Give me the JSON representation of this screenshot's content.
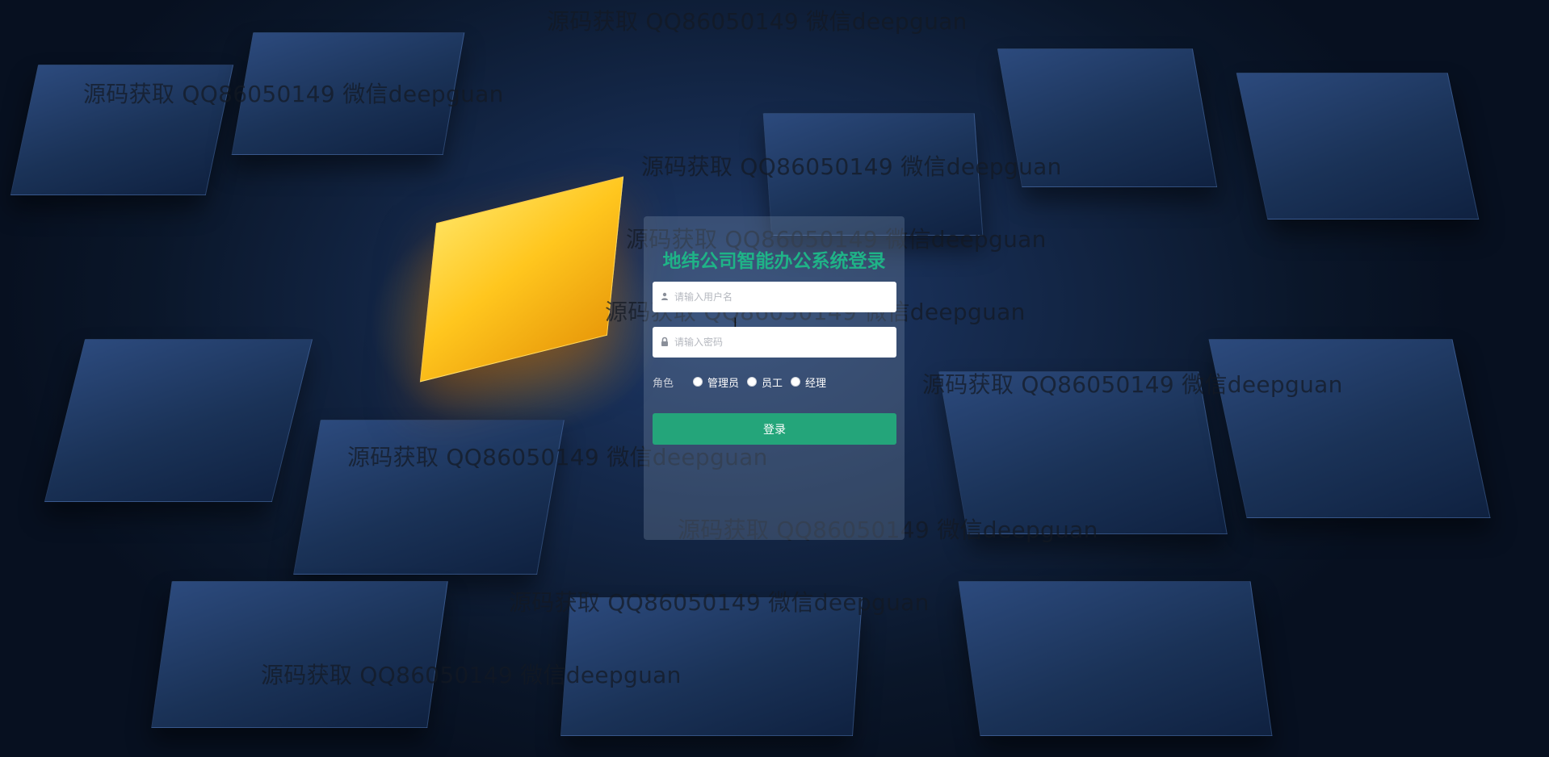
{
  "login": {
    "title": "地纬公司智能办公系统登录",
    "username_placeholder": "请输入用户名",
    "password_placeholder": "请输入密码",
    "role_label": "角色",
    "roles": [
      {
        "label": "管理员"
      },
      {
        "label": "员工"
      },
      {
        "label": "经理"
      }
    ],
    "submit_label": "登录"
  },
  "watermark": {
    "text": "源码获取 QQ86050149 微信deepguan"
  },
  "icons": {
    "username": "user-icon",
    "password": "lock-icon",
    "cursor": "text-cursor-icon"
  },
  "colors": {
    "title": "#1fb387",
    "button": "#24a57a",
    "background": "#0a1629"
  }
}
